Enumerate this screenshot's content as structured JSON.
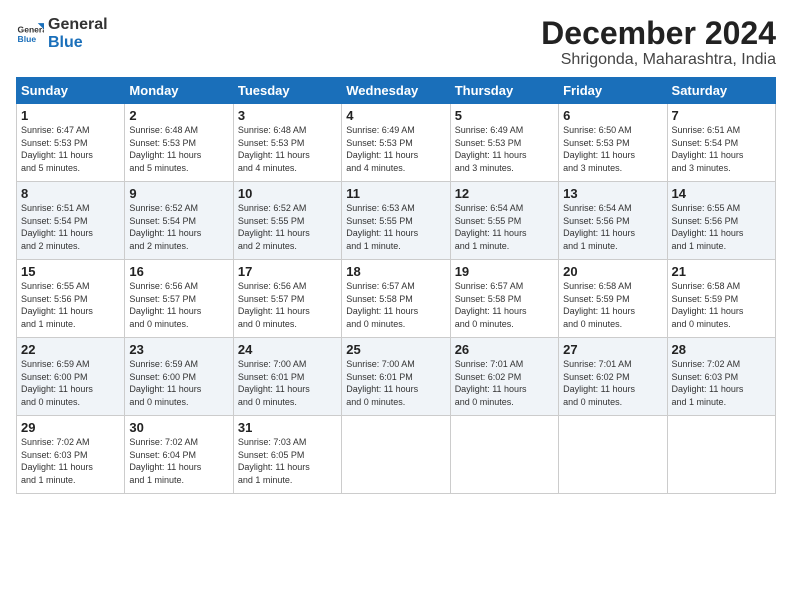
{
  "header": {
    "logo_line1": "General",
    "logo_line2": "Blue",
    "month": "December 2024",
    "location": "Shrigonda, Maharashtra, India"
  },
  "days_of_week": [
    "Sunday",
    "Monday",
    "Tuesday",
    "Wednesday",
    "Thursday",
    "Friday",
    "Saturday"
  ],
  "weeks": [
    [
      {
        "day": "1",
        "detail": "Sunrise: 6:47 AM\nSunset: 5:53 PM\nDaylight: 11 hours\nand 5 minutes."
      },
      {
        "day": "2",
        "detail": "Sunrise: 6:48 AM\nSunset: 5:53 PM\nDaylight: 11 hours\nand 5 minutes."
      },
      {
        "day": "3",
        "detail": "Sunrise: 6:48 AM\nSunset: 5:53 PM\nDaylight: 11 hours\nand 4 minutes."
      },
      {
        "day": "4",
        "detail": "Sunrise: 6:49 AM\nSunset: 5:53 PM\nDaylight: 11 hours\nand 4 minutes."
      },
      {
        "day": "5",
        "detail": "Sunrise: 6:49 AM\nSunset: 5:53 PM\nDaylight: 11 hours\nand 3 minutes."
      },
      {
        "day": "6",
        "detail": "Sunrise: 6:50 AM\nSunset: 5:53 PM\nDaylight: 11 hours\nand 3 minutes."
      },
      {
        "day": "7",
        "detail": "Sunrise: 6:51 AM\nSunset: 5:54 PM\nDaylight: 11 hours\nand 3 minutes."
      }
    ],
    [
      {
        "day": "8",
        "detail": "Sunrise: 6:51 AM\nSunset: 5:54 PM\nDaylight: 11 hours\nand 2 minutes."
      },
      {
        "day": "9",
        "detail": "Sunrise: 6:52 AM\nSunset: 5:54 PM\nDaylight: 11 hours\nand 2 minutes."
      },
      {
        "day": "10",
        "detail": "Sunrise: 6:52 AM\nSunset: 5:55 PM\nDaylight: 11 hours\nand 2 minutes."
      },
      {
        "day": "11",
        "detail": "Sunrise: 6:53 AM\nSunset: 5:55 PM\nDaylight: 11 hours\nand 1 minute."
      },
      {
        "day": "12",
        "detail": "Sunrise: 6:54 AM\nSunset: 5:55 PM\nDaylight: 11 hours\nand 1 minute."
      },
      {
        "day": "13",
        "detail": "Sunrise: 6:54 AM\nSunset: 5:56 PM\nDaylight: 11 hours\nand 1 minute."
      },
      {
        "day": "14",
        "detail": "Sunrise: 6:55 AM\nSunset: 5:56 PM\nDaylight: 11 hours\nand 1 minute."
      }
    ],
    [
      {
        "day": "15",
        "detail": "Sunrise: 6:55 AM\nSunset: 5:56 PM\nDaylight: 11 hours\nand 1 minute."
      },
      {
        "day": "16",
        "detail": "Sunrise: 6:56 AM\nSunset: 5:57 PM\nDaylight: 11 hours\nand 0 minutes."
      },
      {
        "day": "17",
        "detail": "Sunrise: 6:56 AM\nSunset: 5:57 PM\nDaylight: 11 hours\nand 0 minutes."
      },
      {
        "day": "18",
        "detail": "Sunrise: 6:57 AM\nSunset: 5:58 PM\nDaylight: 11 hours\nand 0 minutes."
      },
      {
        "day": "19",
        "detail": "Sunrise: 6:57 AM\nSunset: 5:58 PM\nDaylight: 11 hours\nand 0 minutes."
      },
      {
        "day": "20",
        "detail": "Sunrise: 6:58 AM\nSunset: 5:59 PM\nDaylight: 11 hours\nand 0 minutes."
      },
      {
        "day": "21",
        "detail": "Sunrise: 6:58 AM\nSunset: 5:59 PM\nDaylight: 11 hours\nand 0 minutes."
      }
    ],
    [
      {
        "day": "22",
        "detail": "Sunrise: 6:59 AM\nSunset: 6:00 PM\nDaylight: 11 hours\nand 0 minutes."
      },
      {
        "day": "23",
        "detail": "Sunrise: 6:59 AM\nSunset: 6:00 PM\nDaylight: 11 hours\nand 0 minutes."
      },
      {
        "day": "24",
        "detail": "Sunrise: 7:00 AM\nSunset: 6:01 PM\nDaylight: 11 hours\nand 0 minutes."
      },
      {
        "day": "25",
        "detail": "Sunrise: 7:00 AM\nSunset: 6:01 PM\nDaylight: 11 hours\nand 0 minutes."
      },
      {
        "day": "26",
        "detail": "Sunrise: 7:01 AM\nSunset: 6:02 PM\nDaylight: 11 hours\nand 0 minutes."
      },
      {
        "day": "27",
        "detail": "Sunrise: 7:01 AM\nSunset: 6:02 PM\nDaylight: 11 hours\nand 0 minutes."
      },
      {
        "day": "28",
        "detail": "Sunrise: 7:02 AM\nSunset: 6:03 PM\nDaylight: 11 hours\nand 1 minute."
      }
    ],
    [
      {
        "day": "29",
        "detail": "Sunrise: 7:02 AM\nSunset: 6:03 PM\nDaylight: 11 hours\nand 1 minute."
      },
      {
        "day": "30",
        "detail": "Sunrise: 7:02 AM\nSunset: 6:04 PM\nDaylight: 11 hours\nand 1 minute."
      },
      {
        "day": "31",
        "detail": "Sunrise: 7:03 AM\nSunset: 6:05 PM\nDaylight: 11 hours\nand 1 minute."
      },
      {
        "day": "",
        "detail": ""
      },
      {
        "day": "",
        "detail": ""
      },
      {
        "day": "",
        "detail": ""
      },
      {
        "day": "",
        "detail": ""
      }
    ]
  ]
}
